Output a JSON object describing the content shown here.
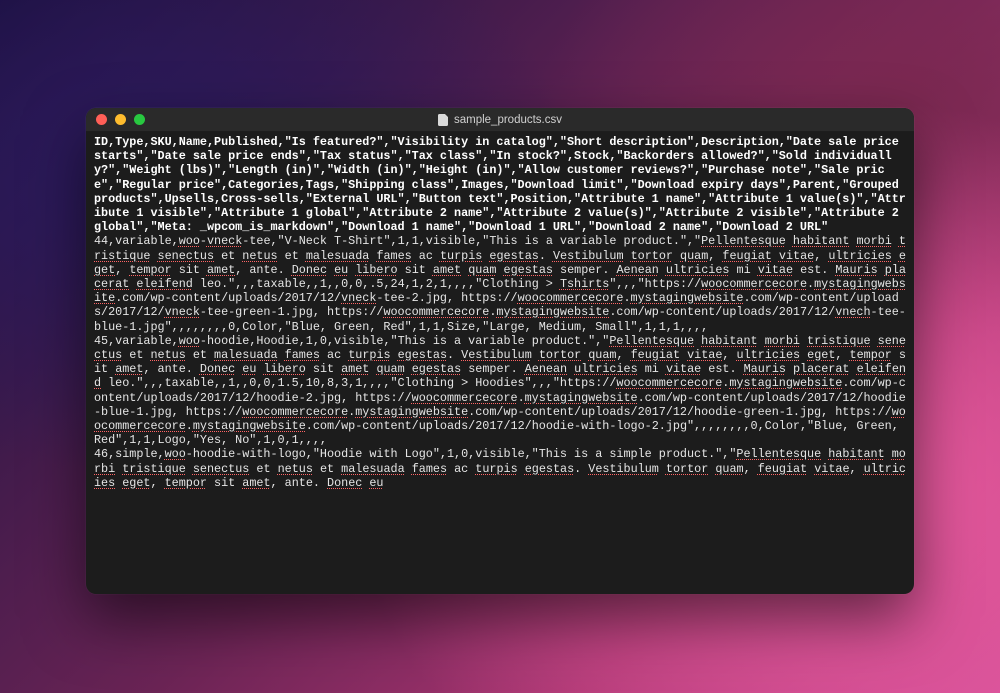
{
  "window": {
    "title": "sample_products.csv"
  },
  "csv": {
    "header": "ID,Type,SKU,Name,Published,\"Is featured?\",\"Visibility in catalog\",\"Short description\",Description,\"Date sale price starts\",\"Date sale price ends\",\"Tax status\",\"Tax class\",\"In stock?\",Stock,\"Backorders allowed?\",\"Sold individually?\",\"Weight (lbs)\",\"Length (in)\",\"Width (in)\",\"Height (in)\",\"Allow customer reviews?\",\"Purchase note\",\"Sale price\",\"Regular price\",Categories,Tags,\"Shipping class\",Images,\"Download limit\",\"Download expiry days\",Parent,\"Grouped products\",Upsells,Cross-sells,\"External URL\",\"Button text\",Position,\"Attribute 1 name\",\"Attribute 1 value(s)\",\"Attribute 1 visible\",\"Attribute 1 global\",\"Attribute 2 name\",\"Attribute 2 value(s)\",\"Attribute 2 visible\",\"Attribute 2 global\",\"Meta: _wpcom_is_markdown\",\"Download 1 name\",\"Download 1 URL\",\"Download 2 name\",\"Download 2 URL\"",
    "rows": [
      "44,variable,woo-vneck-tee,\"V-Neck T-Shirt\",1,1,visible,\"This is a variable product.\",\"Pellentesque habitant morbi tristique senectus et netus et malesuada fames ac turpis egestas. Vestibulum tortor quam, feugiat vitae, ultricies eget, tempor sit amet, ante. Donec eu libero sit amet quam egestas semper. Aenean ultricies mi vitae est. Mauris placerat eleifend leo.\",,,taxable,,1,,0,0,.5,24,1,2,1,,,,\"Clothing > Tshirts\",,,\"https://woocommercecore.mystagingwebsite.com/wp-content/uploads/2017/12/vneck-tee-2.jpg, https://woocommercecore.mystagingwebsite.com/wp-content/uploads/2017/12/vneck-tee-green-1.jpg, https://woocommercecore.mystagingwebsite.com/wp-content/uploads/2017/12/vnech-tee-blue-1.jpg\",,,,,,,,0,Color,\"Blue, Green, Red\",1,1,Size,\"Large, Medium, Small\",1,1,1,,,,",
      "45,variable,woo-hoodie,Hoodie,1,0,visible,\"This is a variable product.\",\"Pellentesque habitant morbi tristique senectus et netus et malesuada fames ac turpis egestas. Vestibulum tortor quam, feugiat vitae, ultricies eget, tempor sit amet, ante. Donec eu libero sit amet quam egestas semper. Aenean ultricies mi vitae est. Mauris placerat eleifend leo.\",,,taxable,,1,,0,0,1.5,10,8,3,1,,,,\"Clothing > Hoodies\",,,\"https://woocommercecore.mystagingwebsite.com/wp-content/uploads/2017/12/hoodie-2.jpg, https://woocommercecore.mystagingwebsite.com/wp-content/uploads/2017/12/hoodie-blue-1.jpg, https://woocommercecore.mystagingwebsite.com/wp-content/uploads/2017/12/hoodie-green-1.jpg, https://woocommercecore.mystagingwebsite.com/wp-content/uploads/2017/12/hoodie-with-logo-2.jpg\",,,,,,,,0,Color,\"Blue, Green, Red\",1,1,Logo,\"Yes, No\",1,0,1,,,,",
      "46,simple,woo-hoodie-with-logo,\"Hoodie with Logo\",1,0,visible,\"This is a simple product.\",\"Pellentesque habitant morbi tristique senectus et netus et malesuada fames ac turpis egestas. Vestibulum tortor quam, feugiat vitae, ultricies eget, tempor sit amet, ante. Donec eu"
    ],
    "spellcheck_words": [
      "wpcom",
      "vneck",
      "Pellentesque",
      "habitant",
      "morbi",
      "tristique",
      "senectus",
      "netus",
      "malesuada",
      "fames",
      "turpis",
      "egestas",
      "Vestibulum",
      "tortor",
      "quam",
      "feugiat",
      "vitae",
      "ultricies",
      "eget",
      "tempor",
      "amet",
      "Donec",
      "eu",
      "libero",
      "egestas",
      "Aenean",
      "ultricies",
      "Mauris",
      "placerat",
      "eleifend",
      "Tshirts",
      "woocommercecore",
      "mystagingwebsite",
      "vnech",
      "woo"
    ]
  }
}
